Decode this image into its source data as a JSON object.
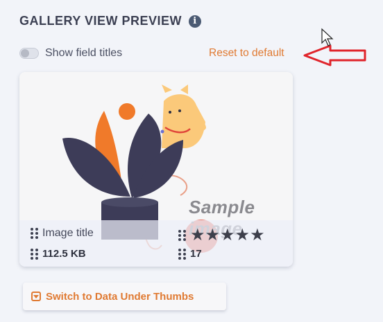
{
  "header": {
    "title": "GALLERY VIEW PREVIEW",
    "info_icon": "info-icon"
  },
  "toggle": {
    "label": "Show field titles",
    "checked": false
  },
  "reset": {
    "label": "Reset to default"
  },
  "card": {
    "watermark": "Sample image",
    "fields": {
      "image_title": "Image title",
      "file_size": "112.5 KB",
      "rating_stars": "★★★★★",
      "count": "17"
    }
  },
  "switch_button": {
    "label": "Switch to Data Under Thumbs",
    "icon": "dropdown-icon"
  },
  "colors": {
    "accent": "#e07a32",
    "annotation_arrow": "#e0242b",
    "dark": "#3d3f55"
  }
}
